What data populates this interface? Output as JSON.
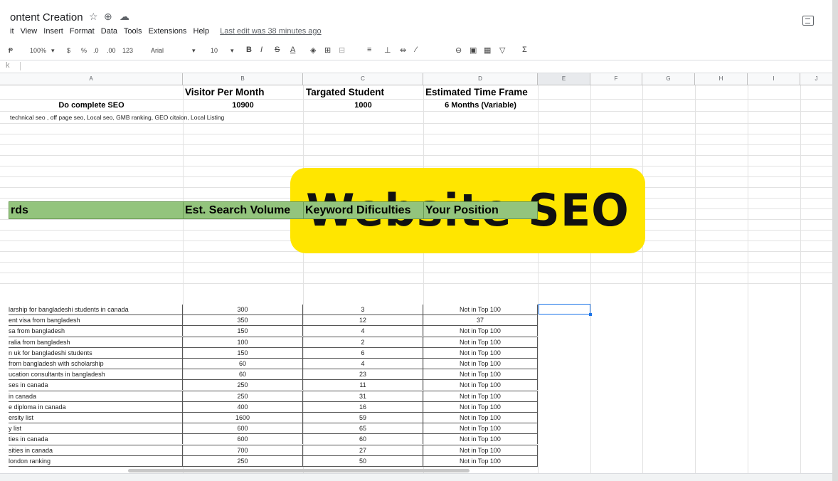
{
  "doc": {
    "title": "ontent Creation",
    "menu": [
      "it",
      "View",
      "Insert",
      "Format",
      "Data",
      "Tools",
      "Extensions",
      "Help"
    ],
    "last_edit": "Last edit was 38 minutes ago"
  },
  "toolbar": {
    "zoom": "100%",
    "currency": "$",
    "percent": "%",
    "dec_less": ".0",
    "dec_more": ".00",
    "fmt": "123",
    "font": "Arial",
    "size": "10",
    "bold": "B",
    "italic": "I",
    "strike": "S",
    "textcolor": "A",
    "sigma": "Σ"
  },
  "columns": [
    "A",
    "B",
    "C",
    "D",
    "E",
    "F",
    "G",
    "H",
    "I",
    "J"
  ],
  "summary": {
    "headers": [
      "Visitor Per Month",
      "Targated Student",
      "Estimated Time Frame"
    ],
    "task": "Do complete SEO",
    "visitors": "10900",
    "students": "1000",
    "timeframe": "6 Months (Variable)",
    "note": "technical seo , off page seo, Local seo, GMB ranking, GEO citaion, Local Listing"
  },
  "badge": "Website SEO",
  "table": {
    "headers": [
      "rds",
      "Est. Search Volume",
      "Keyword Dificulties",
      "Your Position"
    ],
    "rows": [
      {
        "kw": "larship for bangladeshi students in canada",
        "vol": "300",
        "kd": "3",
        "pos": "Not in Top 100"
      },
      {
        "kw": "ent visa from bangladesh",
        "vol": "350",
        "kd": "12",
        "pos": "37"
      },
      {
        "kw": "sa from bangladesh",
        "vol": "150",
        "kd": "4",
        "pos": "Not in Top 100"
      },
      {
        "kw": "ralia from bangladesh",
        "vol": "100",
        "kd": "2",
        "pos": "Not in Top 100"
      },
      {
        "kw": "n uk for bangladeshi students",
        "vol": "150",
        "kd": "6",
        "pos": "Not in Top 100"
      },
      {
        "kw": "from bangladesh with scholarship",
        "vol": "60",
        "kd": "4",
        "pos": "Not in Top 100"
      },
      {
        "kw": "ucation consultants in bangladesh",
        "vol": "60",
        "kd": "23",
        "pos": "Not in Top 100"
      },
      {
        "kw": "ses in canada",
        "vol": "250",
        "kd": "11",
        "pos": "Not in Top 100"
      },
      {
        "kw": "in canada",
        "vol": "250",
        "kd": "31",
        "pos": "Not in Top 100"
      },
      {
        "kw": "e diploma in canada",
        "vol": "400",
        "kd": "16",
        "pos": "Not in Top 100"
      },
      {
        "kw": "ersity list",
        "vol": "1600",
        "kd": "59",
        "pos": "Not in Top 100"
      },
      {
        "kw": "y list",
        "vol": "600",
        "kd": "65",
        "pos": "Not in Top 100"
      },
      {
        "kw": "ties in canada",
        "vol": "600",
        "kd": "60",
        "pos": "Not in Top 100"
      },
      {
        "kw": "sities in canada",
        "vol": "700",
        "kd": "27",
        "pos": "Not in Top 100"
      },
      {
        "kw": "london ranking",
        "vol": "250",
        "kd": "50",
        "pos": "Not in Top 100"
      }
    ]
  }
}
